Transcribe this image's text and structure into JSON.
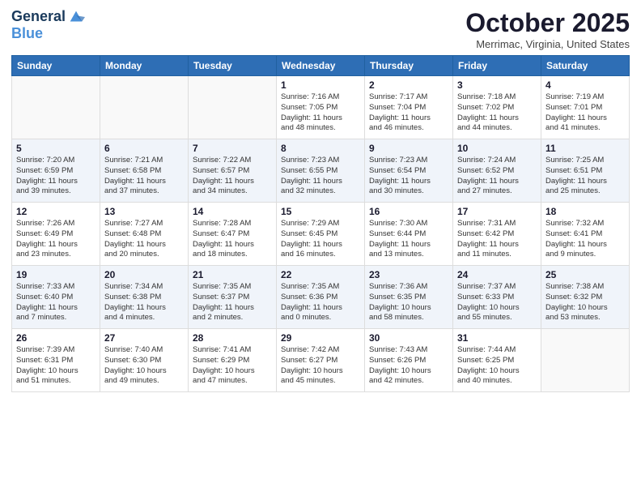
{
  "header": {
    "logo_line1": "General",
    "logo_line2": "Blue",
    "month": "October 2025",
    "location": "Merrimac, Virginia, United States"
  },
  "weekdays": [
    "Sunday",
    "Monday",
    "Tuesday",
    "Wednesday",
    "Thursday",
    "Friday",
    "Saturday"
  ],
  "weeks": [
    [
      {
        "day": "",
        "info": ""
      },
      {
        "day": "",
        "info": ""
      },
      {
        "day": "",
        "info": ""
      },
      {
        "day": "1",
        "info": "Sunrise: 7:16 AM\nSunset: 7:05 PM\nDaylight: 11 hours\nand 48 minutes."
      },
      {
        "day": "2",
        "info": "Sunrise: 7:17 AM\nSunset: 7:04 PM\nDaylight: 11 hours\nand 46 minutes."
      },
      {
        "day": "3",
        "info": "Sunrise: 7:18 AM\nSunset: 7:02 PM\nDaylight: 11 hours\nand 44 minutes."
      },
      {
        "day": "4",
        "info": "Sunrise: 7:19 AM\nSunset: 7:01 PM\nDaylight: 11 hours\nand 41 minutes."
      }
    ],
    [
      {
        "day": "5",
        "info": "Sunrise: 7:20 AM\nSunset: 6:59 PM\nDaylight: 11 hours\nand 39 minutes."
      },
      {
        "day": "6",
        "info": "Sunrise: 7:21 AM\nSunset: 6:58 PM\nDaylight: 11 hours\nand 37 minutes."
      },
      {
        "day": "7",
        "info": "Sunrise: 7:22 AM\nSunset: 6:57 PM\nDaylight: 11 hours\nand 34 minutes."
      },
      {
        "day": "8",
        "info": "Sunrise: 7:23 AM\nSunset: 6:55 PM\nDaylight: 11 hours\nand 32 minutes."
      },
      {
        "day": "9",
        "info": "Sunrise: 7:23 AM\nSunset: 6:54 PM\nDaylight: 11 hours\nand 30 minutes."
      },
      {
        "day": "10",
        "info": "Sunrise: 7:24 AM\nSunset: 6:52 PM\nDaylight: 11 hours\nand 27 minutes."
      },
      {
        "day": "11",
        "info": "Sunrise: 7:25 AM\nSunset: 6:51 PM\nDaylight: 11 hours\nand 25 minutes."
      }
    ],
    [
      {
        "day": "12",
        "info": "Sunrise: 7:26 AM\nSunset: 6:49 PM\nDaylight: 11 hours\nand 23 minutes."
      },
      {
        "day": "13",
        "info": "Sunrise: 7:27 AM\nSunset: 6:48 PM\nDaylight: 11 hours\nand 20 minutes."
      },
      {
        "day": "14",
        "info": "Sunrise: 7:28 AM\nSunset: 6:47 PM\nDaylight: 11 hours\nand 18 minutes."
      },
      {
        "day": "15",
        "info": "Sunrise: 7:29 AM\nSunset: 6:45 PM\nDaylight: 11 hours\nand 16 minutes."
      },
      {
        "day": "16",
        "info": "Sunrise: 7:30 AM\nSunset: 6:44 PM\nDaylight: 11 hours\nand 13 minutes."
      },
      {
        "day": "17",
        "info": "Sunrise: 7:31 AM\nSunset: 6:42 PM\nDaylight: 11 hours\nand 11 minutes."
      },
      {
        "day": "18",
        "info": "Sunrise: 7:32 AM\nSunset: 6:41 PM\nDaylight: 11 hours\nand 9 minutes."
      }
    ],
    [
      {
        "day": "19",
        "info": "Sunrise: 7:33 AM\nSunset: 6:40 PM\nDaylight: 11 hours\nand 7 minutes."
      },
      {
        "day": "20",
        "info": "Sunrise: 7:34 AM\nSunset: 6:38 PM\nDaylight: 11 hours\nand 4 minutes."
      },
      {
        "day": "21",
        "info": "Sunrise: 7:35 AM\nSunset: 6:37 PM\nDaylight: 11 hours\nand 2 minutes."
      },
      {
        "day": "22",
        "info": "Sunrise: 7:35 AM\nSunset: 6:36 PM\nDaylight: 11 hours\nand 0 minutes."
      },
      {
        "day": "23",
        "info": "Sunrise: 7:36 AM\nSunset: 6:35 PM\nDaylight: 10 hours\nand 58 minutes."
      },
      {
        "day": "24",
        "info": "Sunrise: 7:37 AM\nSunset: 6:33 PM\nDaylight: 10 hours\nand 55 minutes."
      },
      {
        "day": "25",
        "info": "Sunrise: 7:38 AM\nSunset: 6:32 PM\nDaylight: 10 hours\nand 53 minutes."
      }
    ],
    [
      {
        "day": "26",
        "info": "Sunrise: 7:39 AM\nSunset: 6:31 PM\nDaylight: 10 hours\nand 51 minutes."
      },
      {
        "day": "27",
        "info": "Sunrise: 7:40 AM\nSunset: 6:30 PM\nDaylight: 10 hours\nand 49 minutes."
      },
      {
        "day": "28",
        "info": "Sunrise: 7:41 AM\nSunset: 6:29 PM\nDaylight: 10 hours\nand 47 minutes."
      },
      {
        "day": "29",
        "info": "Sunrise: 7:42 AM\nSunset: 6:27 PM\nDaylight: 10 hours\nand 45 minutes."
      },
      {
        "day": "30",
        "info": "Sunrise: 7:43 AM\nSunset: 6:26 PM\nDaylight: 10 hours\nand 42 minutes."
      },
      {
        "day": "31",
        "info": "Sunrise: 7:44 AM\nSunset: 6:25 PM\nDaylight: 10 hours\nand 40 minutes."
      },
      {
        "day": "",
        "info": ""
      }
    ]
  ]
}
